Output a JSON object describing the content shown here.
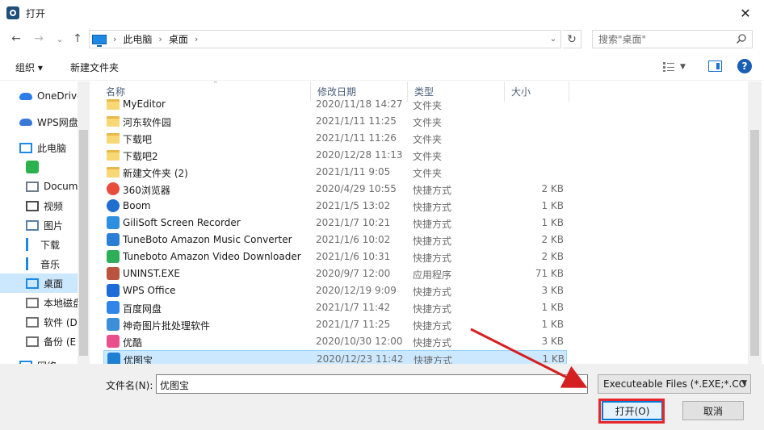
{
  "window": {
    "title": "打开",
    "close_glyph": "✕"
  },
  "address": {
    "back_glyph": "←",
    "forward_glyph": "→",
    "recent_glyph": "⌄",
    "up_glyph": "↑",
    "crumbs": [
      "此电脑",
      "桌面"
    ],
    "crumb_sep": "›",
    "refresh_glyph": "↻",
    "search_placeholder": "搜索\"桌面\""
  },
  "toolbar": {
    "organize": "组织 ▾",
    "new_folder": "新建文件夹",
    "help": "?"
  },
  "nav": {
    "items": [
      {
        "label": "OneDrive",
        "icon": "cloud-icon"
      },
      {
        "label": "WPS网盘",
        "icon": "wps-cloud-icon"
      },
      {
        "label": "此电脑",
        "icon": "computer-icon"
      },
      {
        "label": "",
        "icon": "wechat-files-icon"
      },
      {
        "label": "Documents",
        "icon": "documents-icon"
      },
      {
        "label": "视频",
        "icon": "video-icon"
      },
      {
        "label": "图片",
        "icon": "pictures-icon"
      },
      {
        "label": "下载",
        "icon": "download-icon"
      },
      {
        "label": "音乐",
        "icon": "music-icon"
      },
      {
        "label": "桌面",
        "icon": "desktop-icon",
        "selected": true
      },
      {
        "label": "本地磁盘",
        "icon": "disk-icon"
      },
      {
        "label": "软件 (D",
        "icon": "drive-icon"
      },
      {
        "label": "备份 (E",
        "icon": "drive-icon"
      },
      {
        "label": "网络",
        "icon": "network-icon"
      }
    ]
  },
  "columns": {
    "name": "名称",
    "date": "修改日期",
    "type": "类型",
    "size": "大小",
    "sort_glyph": "⌃"
  },
  "files": [
    {
      "name": "MyEditor",
      "date": "2020/11/18 14:27",
      "type": "文件夹",
      "size": "",
      "icon": "folder-icon"
    },
    {
      "name": "河东软件园",
      "date": "2021/1/11 11:25",
      "type": "文件夹",
      "size": "",
      "icon": "folder-icon"
    },
    {
      "name": "下载吧",
      "date": "2021/1/11 11:26",
      "type": "文件夹",
      "size": "",
      "icon": "folder-icon"
    },
    {
      "name": "下载吧2",
      "date": "2020/12/28 11:13",
      "type": "文件夹",
      "size": "",
      "icon": "folder-icon"
    },
    {
      "name": "新建文件夹 (2)",
      "date": "2021/1/11 9:05",
      "type": "文件夹",
      "size": "",
      "icon": "folder-icon"
    },
    {
      "name": "360浏览器",
      "date": "2020/4/29 10:55",
      "type": "快捷方式",
      "size": "2 KB",
      "icon": "browser-360-icon"
    },
    {
      "name": "Boom",
      "date": "2021/1/5 13:02",
      "type": "快捷方式",
      "size": "1 KB",
      "icon": "boom-icon"
    },
    {
      "name": "GiliSoft Screen Recorder",
      "date": "2021/1/7 10:21",
      "type": "快捷方式",
      "size": "1 KB",
      "icon": "screen-recorder-icon"
    },
    {
      "name": "TuneBoto Amazon Music Converter",
      "date": "2021/1/6 10:02",
      "type": "快捷方式",
      "size": "2 KB",
      "icon": "music-converter-icon"
    },
    {
      "name": "Tuneboto Amazon Video Downloader",
      "date": "2021/1/6 10:31",
      "type": "快捷方式",
      "size": "2 KB",
      "icon": "video-downloader-icon"
    },
    {
      "name": "UNINST.EXE",
      "date": "2020/9/7 12:00",
      "type": "应用程序",
      "size": "71 KB",
      "icon": "uninstaller-icon"
    },
    {
      "name": "WPS Office",
      "date": "2020/12/19 9:09",
      "type": "快捷方式",
      "size": "3 KB",
      "icon": "wps-office-icon"
    },
    {
      "name": "百度网盘",
      "date": "2021/1/7 11:42",
      "type": "快捷方式",
      "size": "1 KB",
      "icon": "baidu-netdisk-icon"
    },
    {
      "name": "神奇图片批处理软件",
      "date": "2021/1/7 11:25",
      "type": "快捷方式",
      "size": "1 KB",
      "icon": "image-batch-icon"
    },
    {
      "name": "优酷",
      "date": "2020/10/30 12:00",
      "type": "快捷方式",
      "size": "3 KB",
      "icon": "youku-icon"
    },
    {
      "name": "优图宝",
      "date": "2020/12/23 11:42",
      "type": "快捷方式",
      "size": "1 KB",
      "icon": "youtubao-icon",
      "selected": true
    }
  ],
  "bottom": {
    "filename_label": "文件名(N):",
    "filename_value": "优图宝",
    "filetype_value": "Executeable Files (*.EXE;*.CO",
    "open_label": "打开(O)",
    "cancel_label": "取消"
  },
  "annotation_color": "#e8262a"
}
